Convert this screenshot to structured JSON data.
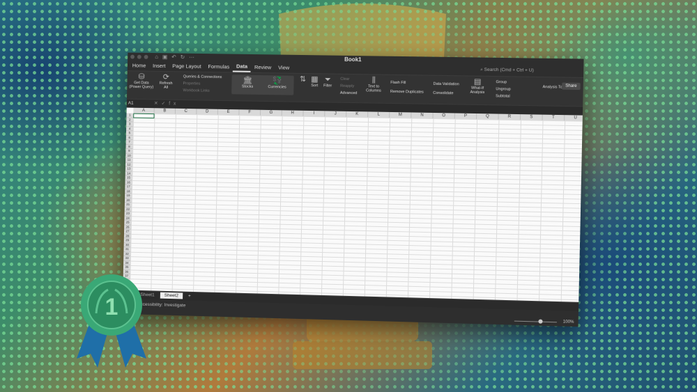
{
  "window": {
    "title": "Book1"
  },
  "tabs": [
    "Home",
    "Insert",
    "Page Layout",
    "Formulas",
    "Data",
    "Review",
    "View"
  ],
  "active_tab": "Data",
  "search_placeholder": "Search (Cmd + Ctrl + U)",
  "ribbon": {
    "get_data": "Get Data (Power Query)",
    "refresh": "Refresh All",
    "queries": "Queries & Connections",
    "properties": "Properties",
    "workbook_links": "Workbook Links",
    "stocks": "Stocks",
    "currencies": "Currencies",
    "sort": "Sort",
    "filter": "Filter",
    "clear": "Clear",
    "reapply": "Reapply",
    "advanced": "Advanced",
    "text_to_columns": "Text to Columns",
    "flash_fill": "Flash Fill",
    "remove_duplicates": "Remove Duplicates",
    "data_validation": "Data Validation",
    "consolidate": "Consolidate",
    "what_if": "What-If Analysis",
    "group": "Group",
    "ungroup": "Ungroup",
    "subtotal": "Subtotal",
    "analysis_tools": "Analysis Tools",
    "share": "Share"
  },
  "formula_bar": {
    "name_box": "A1",
    "fx": "fx"
  },
  "columns": [
    "A",
    "B",
    "C",
    "D",
    "E",
    "F",
    "G",
    "H",
    "I",
    "J",
    "K",
    "L",
    "M",
    "N",
    "O",
    "P",
    "Q",
    "R",
    "S",
    "T",
    "U"
  ],
  "rows": [
    "1",
    "2",
    "3",
    "4",
    "5",
    "6",
    "7",
    "8",
    "9",
    "10",
    "11",
    "12",
    "13",
    "14",
    "15",
    "16",
    "17",
    "18",
    "19",
    "20",
    "21",
    "22",
    "23",
    "24",
    "25",
    "26",
    "27",
    "28",
    "29",
    "30",
    "31",
    "32",
    "33",
    "34",
    "35",
    "36",
    "37",
    "38",
    "39"
  ],
  "sheets": [
    "Sheet1",
    "Sheet2"
  ],
  "active_sheet": "Sheet2",
  "status": {
    "accessibility": "Accessibility: Investigate",
    "zoom": "100%"
  }
}
